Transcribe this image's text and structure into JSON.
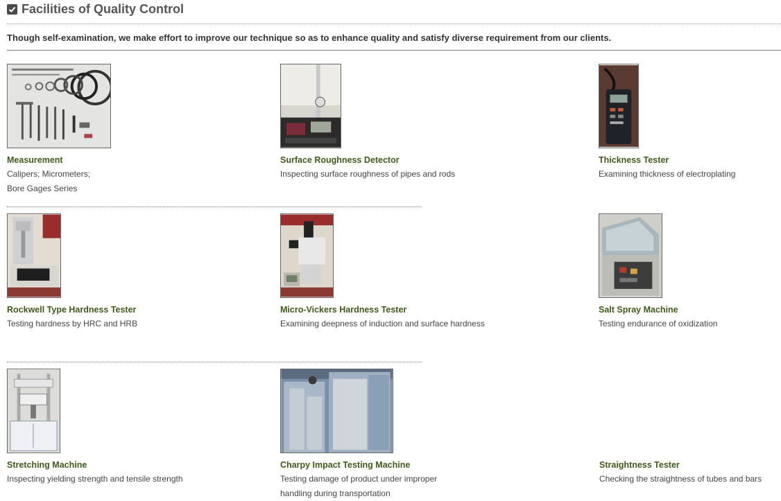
{
  "header": {
    "title": "Facilities of Quality Control"
  },
  "intro": "Though self-examination, we make effort to improve our technique so as to enhance quality and satisfy diverse requirement from our clients.",
  "items": [
    {
      "name": "Measurement",
      "desc": [
        "Calipers; Micrometers;",
        "Bore Gages Series"
      ],
      "image": "measurement-tools-photo"
    },
    {
      "name": "Surface Roughness Detector",
      "desc": [
        "Inspecting surface roughness of pipes and rods"
      ],
      "image": "surface-roughness-detector-photo"
    },
    {
      "name": "Thickness Tester",
      "desc": [
        "Examining thickness of electroplating"
      ],
      "image": "thickness-tester-photo"
    },
    {
      "name": "Rockwell Type Hardness Tester",
      "desc": [
        "Testing hardness by HRC and HRB"
      ],
      "image": "rockwell-hardness-tester-photo"
    },
    {
      "name": "Micro-Vickers Hardness Tester",
      "desc": [
        "Examining deepness of induction and surface hardness"
      ],
      "image": "micro-vickers-tester-photo"
    },
    {
      "name": "Salt Spray Machine",
      "desc": [
        "Testing endurance of oxidization"
      ],
      "image": "salt-spray-machine-photo"
    },
    {
      "name": "Stretching Machine",
      "desc": [
        "Inspecting yielding strength and tensile strength"
      ],
      "image": "stretching-machine-photo"
    },
    {
      "name": "Charpy Impact Testing Machine",
      "desc": [
        "Testing damage of product under improper",
        "handling during transportation"
      ],
      "image": "charpy-impact-machine-photo"
    },
    {
      "name": "Straightness Tester",
      "desc": [
        "Checking the straightness of tubes and bars"
      ],
      "image": ""
    }
  ]
}
